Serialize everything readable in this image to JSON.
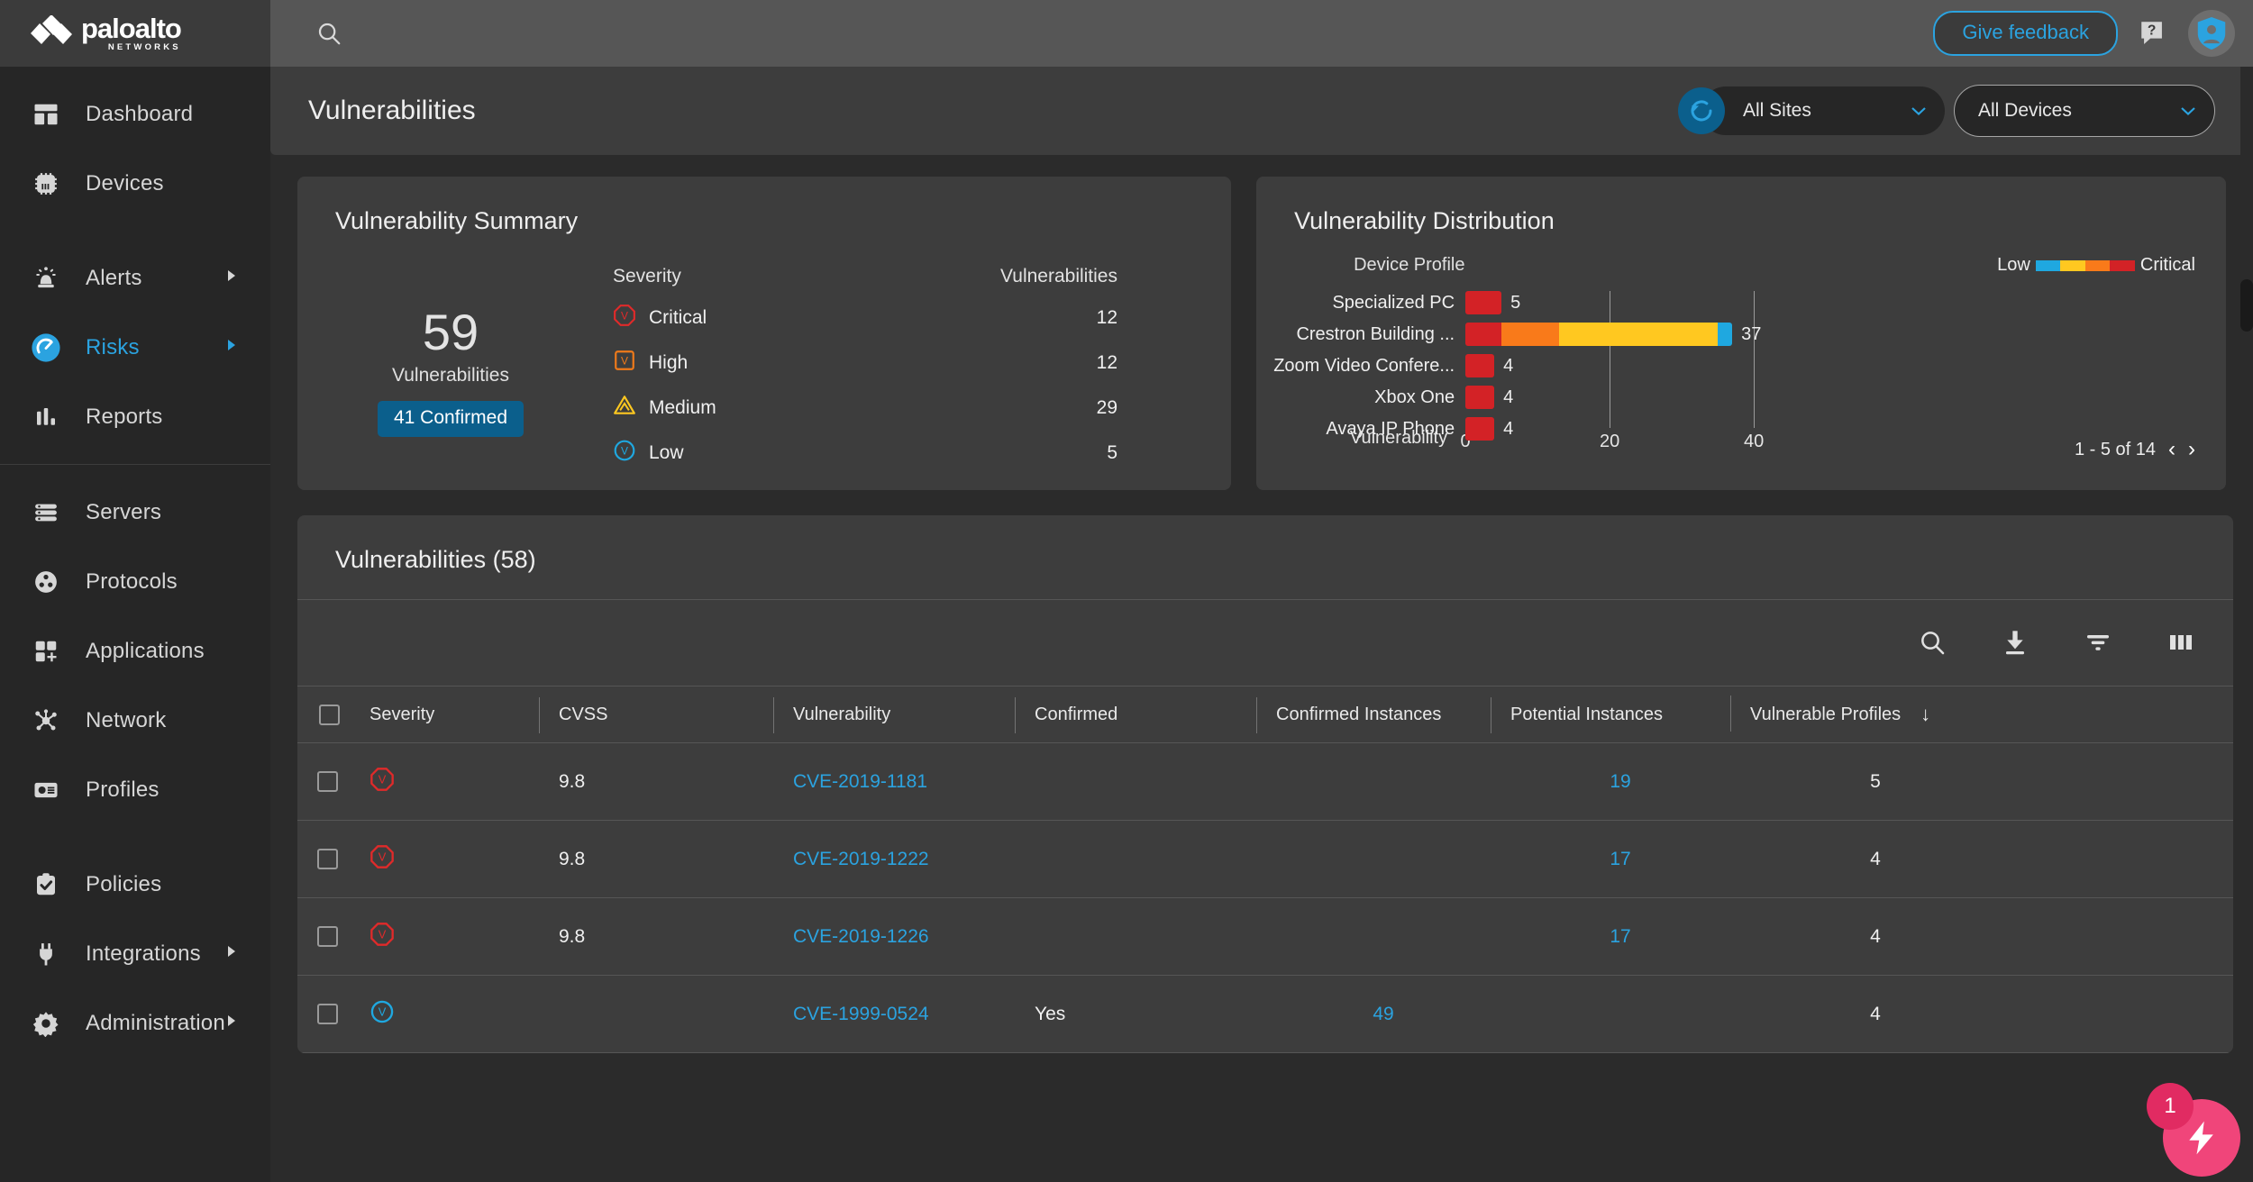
{
  "topbar": {
    "brand_main": "paloalto",
    "brand_sub": "NETWORKS",
    "search_icon": "search-icon",
    "feedback_label": "Give feedback",
    "help_icon": "help-question-icon",
    "avatar_icon": "user-shield-avatar-icon"
  },
  "sidebar": {
    "groups": [
      {
        "items": [
          {
            "label": "Dashboard",
            "icon": "dashboard-grid-icon",
            "active": false,
            "caret": false
          },
          {
            "label": "Devices",
            "icon": "chip-icon",
            "active": false,
            "caret": false
          }
        ]
      },
      {
        "items": [
          {
            "label": "Alerts",
            "icon": "alert-siren-icon",
            "active": false,
            "caret": true
          },
          {
            "label": "Risks",
            "icon": "risk-gauge-icon",
            "active": true,
            "caret": true
          },
          {
            "label": "Reports",
            "icon": "bar-chart-icon",
            "active": false,
            "caret": false
          }
        ]
      },
      {
        "items": [
          {
            "label": "Servers",
            "icon": "server-stack-icon",
            "active": false,
            "caret": false
          },
          {
            "label": "Protocols",
            "icon": "protocols-circle-icon",
            "active": false,
            "caret": false
          },
          {
            "label": "Applications",
            "icon": "applications-grid-plus-icon",
            "active": false,
            "caret": false
          },
          {
            "label": "Network",
            "icon": "network-nodes-icon",
            "active": false,
            "caret": false
          },
          {
            "label": "Profiles",
            "icon": "profile-card-icon",
            "active": false,
            "caret": false
          }
        ]
      },
      {
        "items": [
          {
            "label": "Policies",
            "icon": "clipboard-check-icon",
            "active": false,
            "caret": false
          },
          {
            "label": "Integrations",
            "icon": "plug-icon",
            "active": false,
            "caret": true
          },
          {
            "label": "Administration",
            "icon": "gear-icon",
            "active": false,
            "caret": true
          }
        ]
      }
    ]
  },
  "page": {
    "title": "Vulnerabilities",
    "refresh_icon": "refresh-icon",
    "site_filter": {
      "value": "All Sites",
      "caret": "chevron-down-icon"
    },
    "device_filter": {
      "value": "All Devices",
      "caret": "chevron-down-icon"
    }
  },
  "summary_card": {
    "title": "Vulnerability Summary",
    "total": "59",
    "total_caption": "Vulnerabilities",
    "confirmed_pill": "41 Confirmed",
    "col_severity": "Severity",
    "col_vulnerabilities": "Vulnerabilities",
    "rows": [
      {
        "severity": "Critical",
        "count": "12",
        "color": "#E02A2A",
        "icon": "critical-octagon-icon"
      },
      {
        "severity": "High",
        "count": "12",
        "color": "#F07A1A",
        "icon": "high-square-icon"
      },
      {
        "severity": "Medium",
        "count": "29",
        "color": "#FFC820",
        "icon": "medium-triangle-icon"
      },
      {
        "severity": "Low",
        "count": "5",
        "color": "#1FA8E0",
        "icon": "low-circle-icon"
      }
    ]
  },
  "distribution_card": {
    "title": "Vulnerability Distribution",
    "legend_low": "Low",
    "legend_critical": "Critical",
    "pagination": "1 - 5 of 14",
    "prev_icon": "chevron-left-icon",
    "next_icon": "chevron-right-icon"
  },
  "chart_data": {
    "type": "bar",
    "title": "Vulnerability Distribution",
    "orientation": "horizontal",
    "stacked": true,
    "ylabel": "Device Profile",
    "xlabel": "Vulnerability",
    "categories": [
      "Specialized PC",
      "Crestron Building ...",
      "Zoom Video Confere...",
      "Xbox One",
      "Avaya IP Phone"
    ],
    "totals": [
      5,
      37,
      4,
      4,
      4
    ],
    "series": [
      {
        "name": "Critical",
        "color": "#D32226",
        "values": [
          5,
          5,
          4,
          4,
          4
        ]
      },
      {
        "name": "High",
        "color": "#F97A1A",
        "values": [
          0,
          8,
          0,
          0,
          0
        ]
      },
      {
        "name": "Medium",
        "color": "#FFC820",
        "values": [
          0,
          22,
          0,
          0,
          0
        ]
      },
      {
        "name": "Low",
        "color": "#1FA8E0",
        "values": [
          0,
          2,
          0,
          0,
          0
        ]
      }
    ],
    "xlim": [
      0,
      47
    ],
    "xticks": [
      0,
      20,
      40
    ],
    "xtick_labels": [
      "0",
      "20",
      "40"
    ],
    "grid": true,
    "legend_position": "top-right",
    "legend_entries": [
      "Low",
      "Critical"
    ]
  },
  "table_card": {
    "title": "Vulnerabilities (58)",
    "toolbar_icons": [
      "search-icon",
      "download-icon",
      "filter-icon",
      "columns-icon"
    ],
    "columns": [
      "Severity",
      "CVSS",
      "Vulnerability",
      "Confirmed",
      "Confirmed Instances",
      "Potential Instances",
      "Vulnerable Profiles"
    ],
    "sort_icon": "sort-descending-arrow-icon",
    "rows": [
      {
        "severity_icon": "critical-octagon-icon",
        "severity_color": "#E02A2A",
        "cvss": "9.8",
        "vulnerability": "CVE-2019-1181",
        "confirmed": "",
        "confirmed_instances": "",
        "potential_instances": "19",
        "vulnerable_profiles": "5"
      },
      {
        "severity_icon": "critical-octagon-icon",
        "severity_color": "#E02A2A",
        "cvss": "9.8",
        "vulnerability": "CVE-2019-1222",
        "confirmed": "",
        "confirmed_instances": "",
        "potential_instances": "17",
        "vulnerable_profiles": "4"
      },
      {
        "severity_icon": "critical-octagon-icon",
        "severity_color": "#E02A2A",
        "cvss": "9.8",
        "vulnerability": "CVE-2019-1226",
        "confirmed": "",
        "confirmed_instances": "",
        "potential_instances": "17",
        "vulnerable_profiles": "4"
      },
      {
        "severity_icon": "low-circle-icon",
        "severity_color": "#1FA8E0",
        "cvss": "",
        "vulnerability": "CVE-1999-0524",
        "confirmed": "Yes",
        "confirmed_instances": "49",
        "potential_instances": "",
        "vulnerable_profiles": "4"
      }
    ]
  },
  "fab": {
    "badge": "1",
    "icon": "lightning-bolt-icon",
    "color": "#F0457A"
  }
}
